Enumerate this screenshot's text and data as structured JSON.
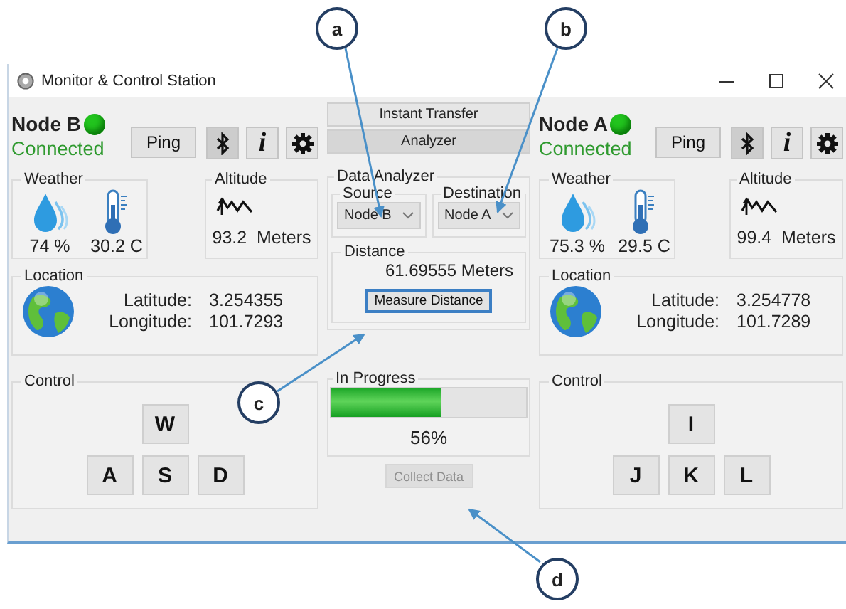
{
  "window": {
    "title": "Monitor & Control Station"
  },
  "nodes": [
    {
      "name": "Node B",
      "online": true,
      "status": "Connected",
      "ping": "Ping",
      "bluetooth_active": true,
      "info": "i",
      "weather": {
        "title": "Weather",
        "humidity": "74 %",
        "temperature": "30.2 C"
      },
      "altitude": {
        "title": "Altitude",
        "reading": "93.2  Meters"
      },
      "location": {
        "title": "Location",
        "latitude_label": "Latitude:",
        "latitude": "3.254355",
        "longitude_label": "Longitude:",
        "longitude": "101.7293"
      },
      "control": {
        "title": "Control",
        "rows": [
          [
            "",
            "W"
          ],
          [
            "A",
            "S",
            "D"
          ]
        ]
      }
    },
    {
      "name": "Node A",
      "online": true,
      "status": "Connected",
      "ping": "Ping",
      "bluetooth_active": true,
      "info": "i",
      "weather": {
        "title": "Weather",
        "humidity": "75.3 %",
        "temperature": "29.5 C"
      },
      "altitude": {
        "title": "Altitude",
        "reading": "99.4  Meters"
      },
      "location": {
        "title": "Location",
        "latitude_label": "Latitude:",
        "latitude": "3.254778",
        "longitude_label": "Longitude:",
        "longitude": "101.7289"
      },
      "control": {
        "title": "Control",
        "rows": [
          [
            "",
            "I"
          ],
          [
            "J",
            "K",
            "L"
          ]
        ]
      }
    }
  ],
  "center": {
    "tabs": [
      {
        "label": "Instant Transfer",
        "selected": false
      },
      {
        "label": "Analyzer",
        "selected": true
      }
    ],
    "analyzer": {
      "title": "Data Analyzer",
      "source": {
        "label": "Source",
        "value": "Node B"
      },
      "destination": {
        "label": "Destination",
        "value": "Node A"
      },
      "distance": {
        "title": "Distance",
        "reading": "61.69555 Meters",
        "button": "Measure Distance",
        "button_focused": true
      },
      "progress": {
        "title": "In Progress",
        "level": 0.56,
        "reading": "56%"
      },
      "collect_button": {
        "label": "Collect Data",
        "disabled": true
      }
    }
  },
  "callouts": [
    {
      "label": "a"
    },
    {
      "label": "b"
    },
    {
      "label": "c"
    },
    {
      "label": "d"
    }
  ]
}
